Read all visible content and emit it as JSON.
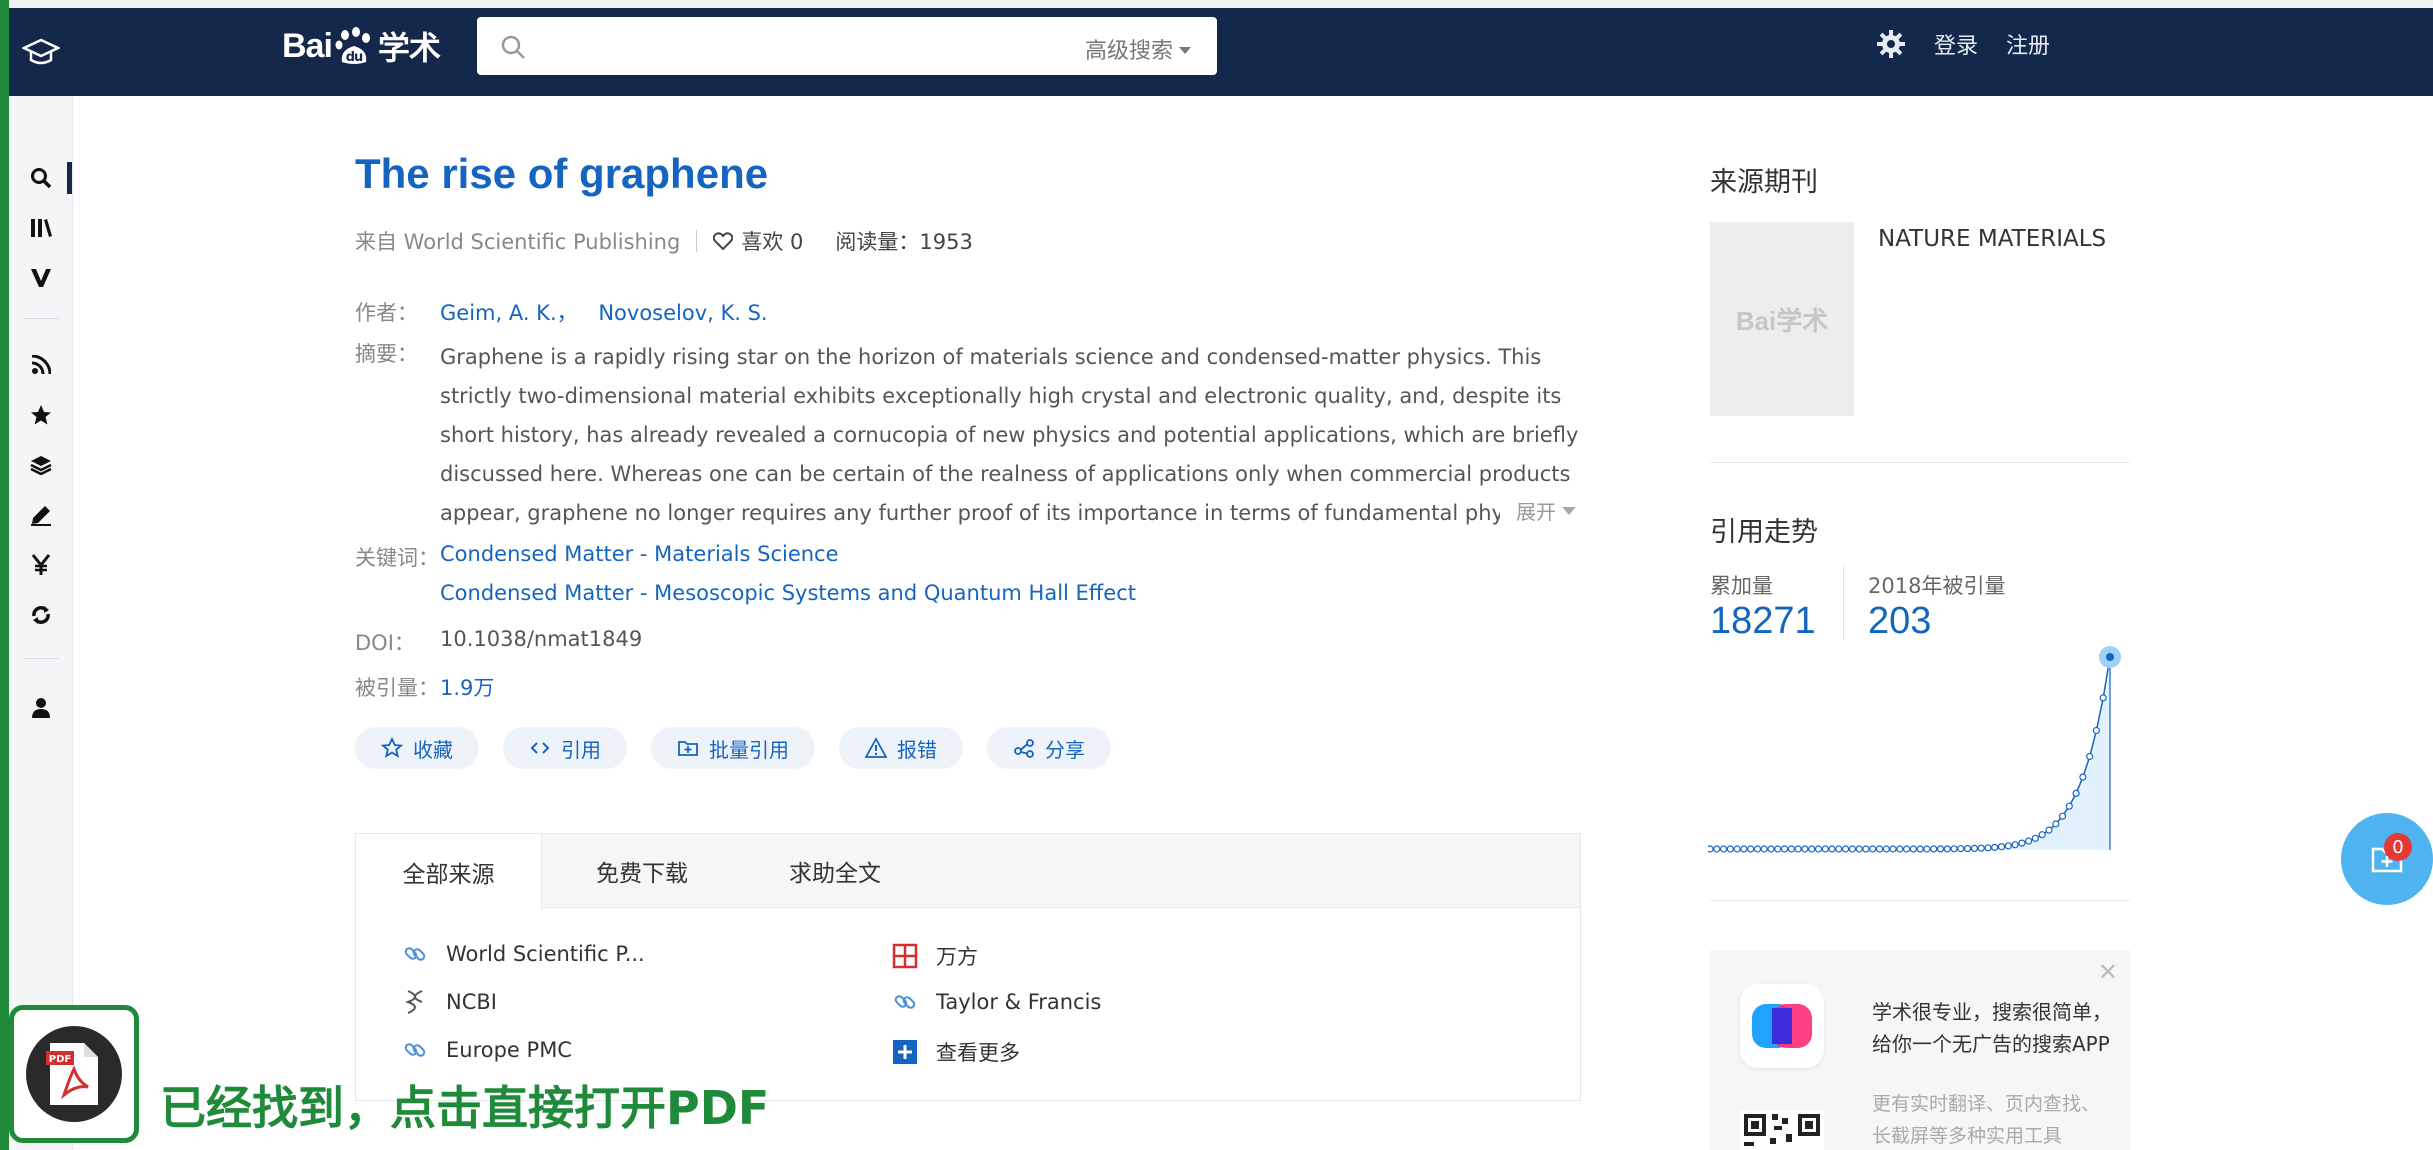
{
  "header": {
    "logo_text_left": "Bai",
    "logo_text_right": "学术",
    "search_placeholder": "",
    "advanced_search_label": "高级搜索",
    "login_label": "登录",
    "register_label": "注册"
  },
  "paper": {
    "title": "The rise of graphene",
    "source": "来自 World Scientific Publishing",
    "likes": "喜欢 0",
    "reads": "阅读量：1953",
    "authors_label": "作者：",
    "authors": [
      "Geim, A. K.，",
      "Novoselov, K. S."
    ],
    "abstract_label": "摘要：",
    "abstract": "Graphene is a rapidly rising star on the horizon of materials science and condensed-matter physics. This strictly two-dimensional material exhibits exceptionally high crystal and electronic quality, and, despite its short history, has already revealed a cornucopia of new physics and potential applications, which are briefly discussed here. Whereas one can be certain of the realness of applications only when commercial products appear, graphene no longer requires any further proof of its importance in terms of fundamental physics. Owing to its unusual",
    "expand_label": "展开",
    "keywords_label": "关键词：",
    "keywords": [
      "Condensed Matter - Materials Science",
      "Condensed Matter - Mesoscopic Systems and Quantum Hall Effect"
    ],
    "doi_label": "DOI：",
    "doi": "10.1038/nmat1849",
    "cited_label": "被引量：",
    "cited": "1.9万"
  },
  "actions": [
    "收藏",
    "引用",
    "批量引用",
    "报错",
    "分享"
  ],
  "sources": {
    "tabs": [
      "全部来源",
      "免费下载",
      "求助全文"
    ],
    "items": [
      "World Scientific P...",
      "万方",
      "NCBI",
      "Taylor & Francis",
      "Europe PMC",
      "查看更多"
    ]
  },
  "sidebar_right": {
    "journal_heading": "来源期刊",
    "journal_thumb_text": "Bai学术",
    "journal_name": "NATURE MATERIALS",
    "trend_heading": "引用走势",
    "cumulative_label": "累加量",
    "cumulative_value": "18271",
    "year_label": "2018年被引量",
    "year_value": "203",
    "ad_line1": "学术很专业，搜索很简单，",
    "ad_line2": "给你一个无广告的搜索APP",
    "ad_line3": "更有实时翻译、页内查找、",
    "ad_line4": "长截屏等多种实用工具"
  },
  "floating": {
    "badge_count": "0"
  },
  "overlay": {
    "message": "已经找到，点击直接打开PDF"
  },
  "colors": {
    "navy": "#13284a",
    "link_blue": "#1565c0",
    "green": "#1f8a3a",
    "float_blue": "#4fb3ef"
  }
}
